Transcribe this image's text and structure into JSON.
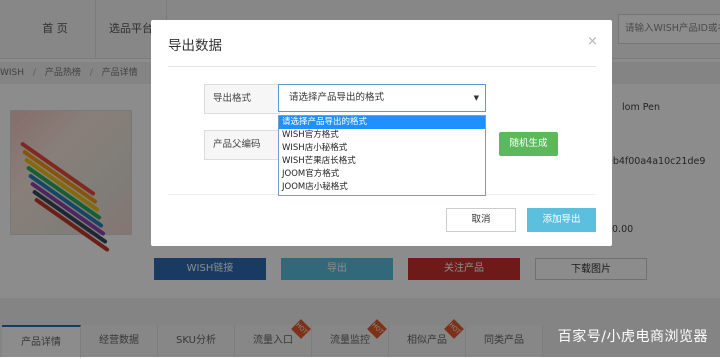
{
  "topnav": {
    "tab_home": "首 页",
    "tab_select": "选品平台",
    "search_placeholder": "请输入WISH产品ID或名"
  },
  "breadcrumb": {
    "item1": "WISH",
    "sep1": "/",
    "item2": "产品热榜",
    "sep2": "/",
    "item3": "产品详情"
  },
  "product": {
    "right_text1": "lom Pen",
    "right_text2": "eb4f00a4a10c21de9",
    "right_text3": "0.00"
  },
  "action_buttons": {
    "wish_link": "WISH链接",
    "export": "导出",
    "follow": "关注产品",
    "download": "下载图片"
  },
  "bottom_tabs": [
    "产品详情",
    "经营数据",
    "SKU分析",
    "流量入口",
    "流量监控",
    "相似产品",
    "同类产品"
  ],
  "hot_badge": "HOT",
  "modal": {
    "title": "导出数据",
    "close": "×",
    "format_label": "导出格式",
    "format_value": "请选择产品导出的格式",
    "arrow": "▼",
    "parent_label": "产品父编码",
    "parent_value": "",
    "random_button": "随机生成",
    "cancel_button": "取消",
    "add_export_button": "添加导出"
  },
  "dropdown_options": [
    "请选择产品导出的格式",
    "WISH官方格式",
    "WISH店小秘格式",
    "WISH芒果店长格式",
    "JOOM官方格式",
    "JOOM店小秘格式"
  ],
  "watermark": "百家号/小虎电商浏览器",
  "colors": {
    "primary_blue": "#5bc0de",
    "green": "#5cb85c",
    "wish_blue": "#2d6ab4",
    "red": "#c9302c",
    "selected_option": "#1e90ff"
  }
}
